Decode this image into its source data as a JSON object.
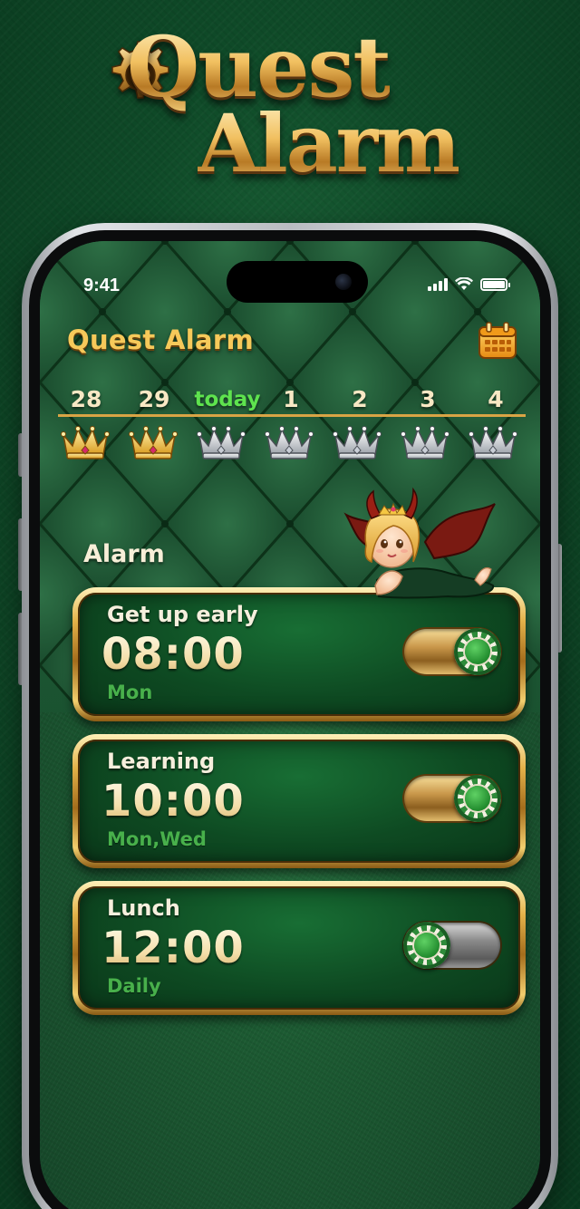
{
  "logo": {
    "line1": "Quest",
    "line2": "Alarm"
  },
  "status_bar": {
    "time": "9:41",
    "battery_level": 1.0
  },
  "app": {
    "title": "Quest Alarm",
    "calendar_icon": "calendar-icon"
  },
  "date_strip": {
    "days": [
      "28",
      "29",
      "today",
      "1",
      "2",
      "3",
      "4"
    ],
    "today_index": 2,
    "crowns": [
      "gold",
      "gold",
      "silver",
      "silver",
      "silver",
      "silver",
      "silver"
    ]
  },
  "alarm_section": {
    "title": "Alarm",
    "alarms": [
      {
        "label": "Get up early",
        "time": "08:00",
        "days": "Mon",
        "enabled": true
      },
      {
        "label": "Learning",
        "time": "10:00",
        "days": "Mon,Wed",
        "enabled": true
      },
      {
        "label": "Lunch",
        "time": "12:00",
        "days": "Daily",
        "enabled": false
      }
    ]
  },
  "colors": {
    "gold": "#f6c95a",
    "today_green": "#5ee34e",
    "days_green": "#48b04b",
    "felt_green": "#174d2c"
  }
}
